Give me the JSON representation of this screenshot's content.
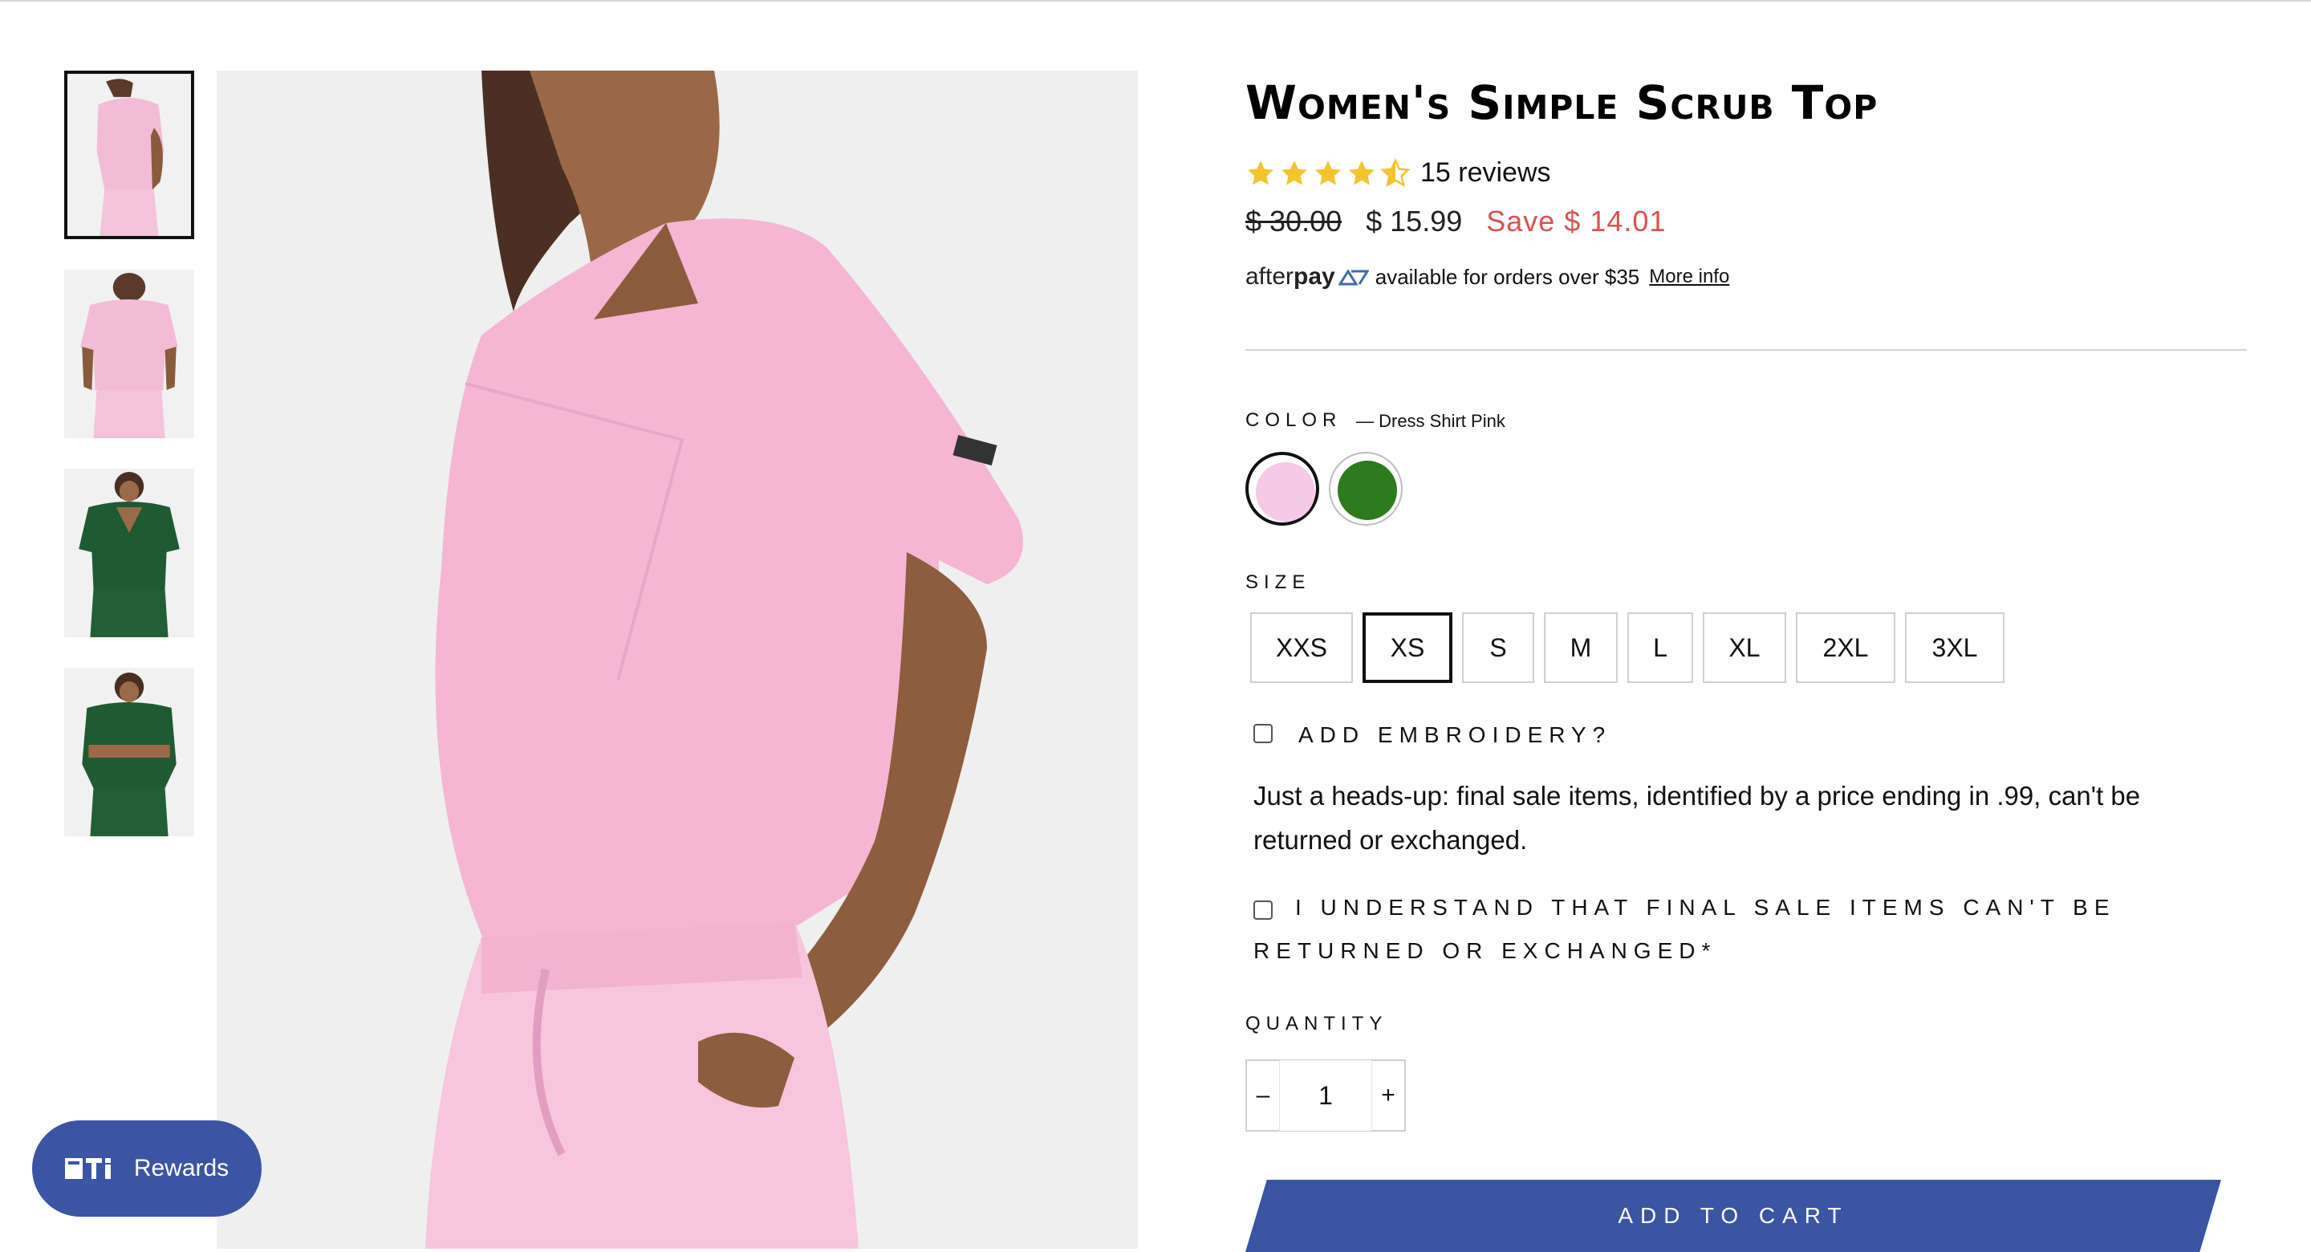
{
  "product": {
    "title": "Women's Simple Scrub Top",
    "rating": 4.5,
    "rating_max": 5,
    "reviews_text": "15 reviews",
    "old_price": "$ 30.00",
    "price": "$ 15.99",
    "save_text": "Save $ 14.01"
  },
  "afterpay": {
    "logo_text_light": "after",
    "logo_text_bold": "pay",
    "message": "available for orders over $35",
    "more_info": "More info"
  },
  "color": {
    "label": "COLOR",
    "selected_name": "— Dress Shirt Pink",
    "swatches": [
      {
        "name": "Dress Shirt Pink",
        "hex": "#f6c9e6",
        "selected": true
      },
      {
        "name": "Green",
        "hex": "#2e7a1e",
        "selected": false
      }
    ]
  },
  "size": {
    "label": "SIZE",
    "options": [
      "XXS",
      "XS",
      "S",
      "M",
      "L",
      "XL",
      "2XL",
      "3XL"
    ],
    "selected": "XS"
  },
  "embroidery": {
    "label": "ADD EMBROIDERY?",
    "checked": false
  },
  "final_sale": {
    "note": "Just a heads-up: final sale items, identified by a price ending in .99, can't be returned or exchanged.",
    "ack_label": "I UNDERSTAND THAT FINAL SALE ITEMS CAN'T BE RETURNED OR EXCHANGED*",
    "checked": false
  },
  "quantity": {
    "label": "QUANTITY",
    "value": "1",
    "minus": "–",
    "plus": "+"
  },
  "cart": {
    "add_label": "ADD TO CART"
  },
  "rewards": {
    "label": "Rewards"
  },
  "colors": {
    "accent": "#3b54a3",
    "sale": "#d9534f",
    "star": "#f4c430"
  }
}
